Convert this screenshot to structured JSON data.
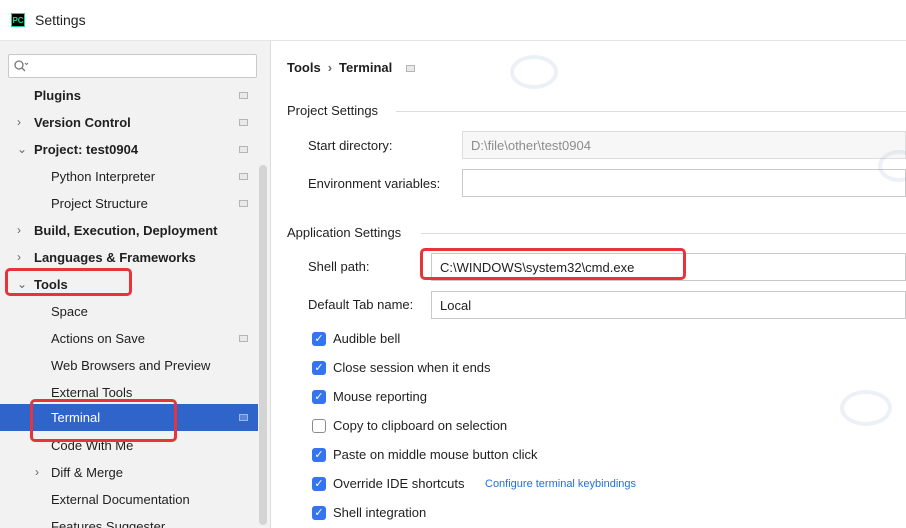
{
  "window": {
    "title": "Settings",
    "app_icon": "PC"
  },
  "search": {
    "placeholder": "",
    "value": ""
  },
  "sidebar": {
    "items": [
      {
        "label": "Plugins",
        "bold": true
      },
      {
        "label": "Version Control",
        "bold": true,
        "arrow": "collapsed"
      },
      {
        "label": "Project: test0904",
        "bold": true,
        "arrow": "expanded"
      },
      {
        "label": "Python Interpreter"
      },
      {
        "label": "Project Structure"
      },
      {
        "label": "Build, Execution, Deployment",
        "bold": true,
        "arrow": "collapsed"
      },
      {
        "label": "Languages & Frameworks",
        "bold": true,
        "arrow": "collapsed"
      },
      {
        "label": "Tools",
        "bold": true,
        "arrow": "expanded"
      },
      {
        "label": "Space"
      },
      {
        "label": "Actions on Save"
      },
      {
        "label": "Web Browsers and Preview"
      },
      {
        "label": "External Tools"
      },
      {
        "label": "Terminal",
        "selected": true
      },
      {
        "label": "Code With Me"
      },
      {
        "label": "Diff & Merge",
        "arrow": "collapsed"
      },
      {
        "label": "External Documentation"
      },
      {
        "label": "Features Suggester"
      }
    ]
  },
  "breadcrumb": {
    "parent": "Tools",
    "separator": "›",
    "current": "Terminal"
  },
  "project_settings": {
    "title": "Project Settings",
    "start_directory": {
      "label": "Start directory:",
      "value": "D:\\file\\other\\test0904"
    },
    "env_variables": {
      "label": "Environment variables:",
      "value": ""
    }
  },
  "application_settings": {
    "title": "Application Settings",
    "shell_path": {
      "label": "Shell path:",
      "value": "C:\\WINDOWS\\system32\\cmd.exe"
    },
    "default_tab_name": {
      "label": "Default Tab name:",
      "value": "Local"
    },
    "checkboxes": [
      {
        "label": "Audible bell",
        "checked": true
      },
      {
        "label": "Close session when it ends",
        "checked": true
      },
      {
        "label": "Mouse reporting",
        "checked": true
      },
      {
        "label": "Copy to clipboard on selection",
        "checked": false
      },
      {
        "label": "Paste on middle mouse button click",
        "checked": true
      },
      {
        "label": "Override IDE shortcuts",
        "checked": true,
        "link": "Configure terminal keybindings"
      },
      {
        "label": "Shell integration",
        "checked": true
      }
    ]
  },
  "colors": {
    "selection": "#2f65ca",
    "highlight": "#e8333b",
    "checkbox": "#3574f0",
    "link": "#2470d6"
  }
}
